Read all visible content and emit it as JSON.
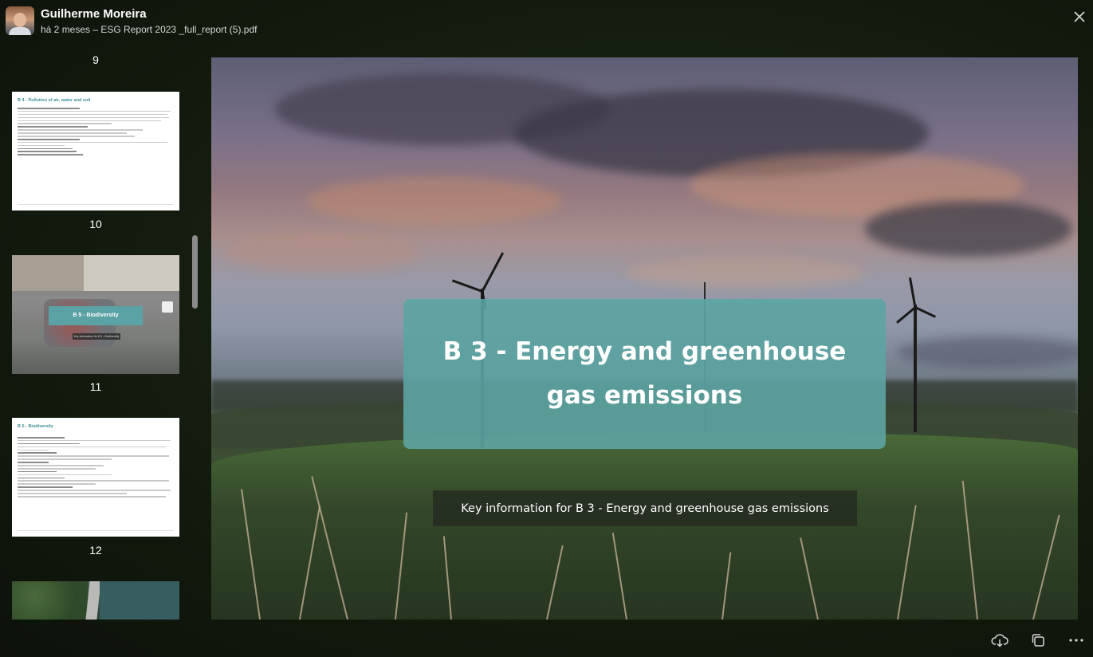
{
  "header": {
    "user_name": "Guilherme Moreira",
    "file_info": "há 2 meses – ESG Report 2023 _full_report (5).pdf"
  },
  "sidebar": {
    "pages": [
      {
        "number": "9"
      },
      {
        "number": "10",
        "thumbnail_title": "B 4 - Pollution of air, water and soil"
      },
      {
        "number": "11",
        "thumbnail_title": "B 5 - Biodiversity",
        "thumbnail_subtitle": "Key information for B 5 - Biodiversity"
      },
      {
        "number": "12",
        "thumbnail_title": "B 5 - Biodiversity"
      }
    ]
  },
  "slide": {
    "title": "B 3 - Energy and greenhouse gas emissions",
    "subtitle": "Key information for B 3 - Energy and greenhouse gas emissions"
  },
  "toolbar": {
    "icons": [
      "download-icon",
      "copy-icon",
      "more-icon"
    ]
  },
  "colors": {
    "accent_teal": "#5ca4a2",
    "doc_title_teal": "#3f8f95"
  }
}
